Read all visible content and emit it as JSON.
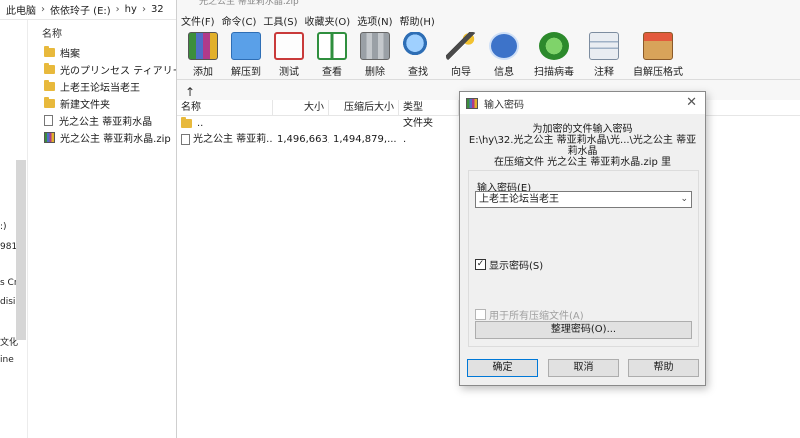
{
  "explorer": {
    "breadcrumb": [
      "此电脑",
      "依依玲子 (E:)",
      "hy",
      "32"
    ],
    "column_header": "名称",
    "nav_fragments": [
      ":)",
      "981",
      "s Cr",
      "disi",
      "文化",
      "ine"
    ],
    "items": [
      {
        "icon": "folder-icon",
        "name": "档案"
      },
      {
        "icon": "folder-icon",
        "name": "光のプリンセス ティアリー"
      },
      {
        "icon": "folder-icon",
        "name": "上老王论坛当老王"
      },
      {
        "icon": "folder-icon",
        "name": "新建文件夹"
      },
      {
        "icon": "document-icon",
        "name": "光之公主 蒂亚莉水晶"
      },
      {
        "icon": "rar-archive-icon",
        "name": "光之公主 蒂亚莉水晶.zip"
      }
    ]
  },
  "winrar": {
    "title": "光之公主 蒂亚莉水晶.zip",
    "menu": [
      "文件(F)",
      "命令(C)",
      "工具(S)",
      "收藏夹(O)",
      "选项(N)",
      "帮助(H)"
    ],
    "toolbar": [
      {
        "icon": "add-icon",
        "label": "添加"
      },
      {
        "icon": "extract-to-icon",
        "label": "解压到"
      },
      {
        "icon": "test-icon",
        "label": "测试"
      },
      {
        "icon": "view-icon",
        "label": "查看"
      },
      {
        "icon": "delete-icon",
        "label": "删除"
      },
      {
        "icon": "find-icon",
        "label": "查找"
      },
      {
        "icon": "wizard-icon",
        "label": "向导"
      },
      {
        "icon": "info-icon",
        "label": "信息"
      },
      {
        "icon": "virus-scan-icon",
        "label": "扫描病毒"
      },
      {
        "icon": "comment-icon",
        "label": "注释"
      },
      {
        "icon": "sfx-icon",
        "label": "自解压格式"
      }
    ],
    "columns": {
      "name": "名称",
      "size": "大小",
      "packed": "压缩后大小",
      "type": "类型"
    },
    "rows": [
      {
        "name": "..",
        "size": "",
        "packed": "",
        "type": "文件夹"
      },
      {
        "name": "光之公主 蒂亚莉...",
        "size": "1,496,663,...",
        "packed": "1,494,879,...",
        "type": "."
      }
    ]
  },
  "dialog": {
    "title": "输入密码",
    "info_lines": [
      "为加密的文件输入密码",
      "E:\\hy\\32.光之公主 蒂亚莉水晶\\光...\\光之公主 蒂亚莉水晶",
      "在压缩文件 光之公主 蒂亚莉水晶.zip 里"
    ],
    "password_label": "输入密码(E)",
    "password_value": "上老王论坛当老王",
    "show_password_label": "显示密码(S)",
    "show_password_checked": true,
    "use_for_all_label": "用于所有压缩文件(A)",
    "organize_label": "整理密码(O)...",
    "ok_label": "确定",
    "cancel_label": "取消",
    "help_label": "帮助"
  }
}
